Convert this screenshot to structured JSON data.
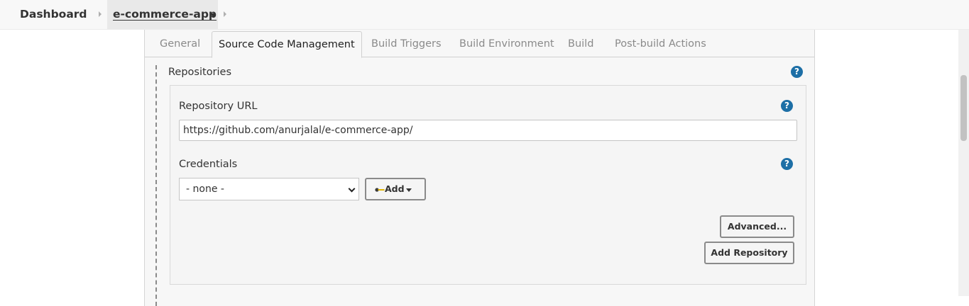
{
  "breadcrumb": {
    "dashboard": "Dashboard",
    "project": "e-commerce-app"
  },
  "tabs": [
    {
      "label": "General"
    },
    {
      "label": "Source Code Management",
      "active": true
    },
    {
      "label": "Build Triggers"
    },
    {
      "label": "Build Environment"
    },
    {
      "label": "Build"
    },
    {
      "label": "Post-build Actions"
    }
  ],
  "repositories": {
    "section_label": "Repositories",
    "help": "?",
    "url_label": "Repository URL",
    "url_value": "https://github.com/anurjalal/e-commerce-app/",
    "credentials_label": "Credentials",
    "credentials_selected": "- none -",
    "add_label": "Add",
    "advanced_label": "Advanced...",
    "add_repository_label": "Add Repository"
  },
  "colors": {
    "help_icon": "#1d6fa6",
    "panel_bg": "#f7f7f7",
    "button_border": "#8a8a8a"
  },
  "icons": [
    "chevron-right-icon",
    "caret-down-icon",
    "help-icon",
    "key-icon"
  ]
}
